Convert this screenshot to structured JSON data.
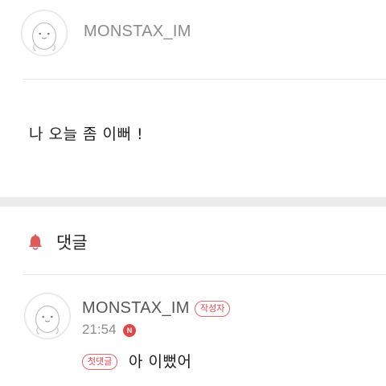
{
  "post": {
    "author": "MONSTAX_IM",
    "avatar_icon": "mascot-face-icon",
    "content": "나 오늘 좀 이뻐 !"
  },
  "comments_section": {
    "title": "댓글",
    "icon": "bell-icon",
    "icon_color": "#e05a5a"
  },
  "comments": [
    {
      "author": "MONSTAX_IM",
      "author_badge": "작성자",
      "time": "21:54",
      "new_badge": "N",
      "first_badge": "첫댓글",
      "text": "아 이뻤어",
      "avatar_icon": "mascot-face-icon"
    }
  ],
  "colors": {
    "accent": "#e05a5a",
    "muted_text": "#8a8a8a",
    "divider": "#e6e6e6"
  }
}
